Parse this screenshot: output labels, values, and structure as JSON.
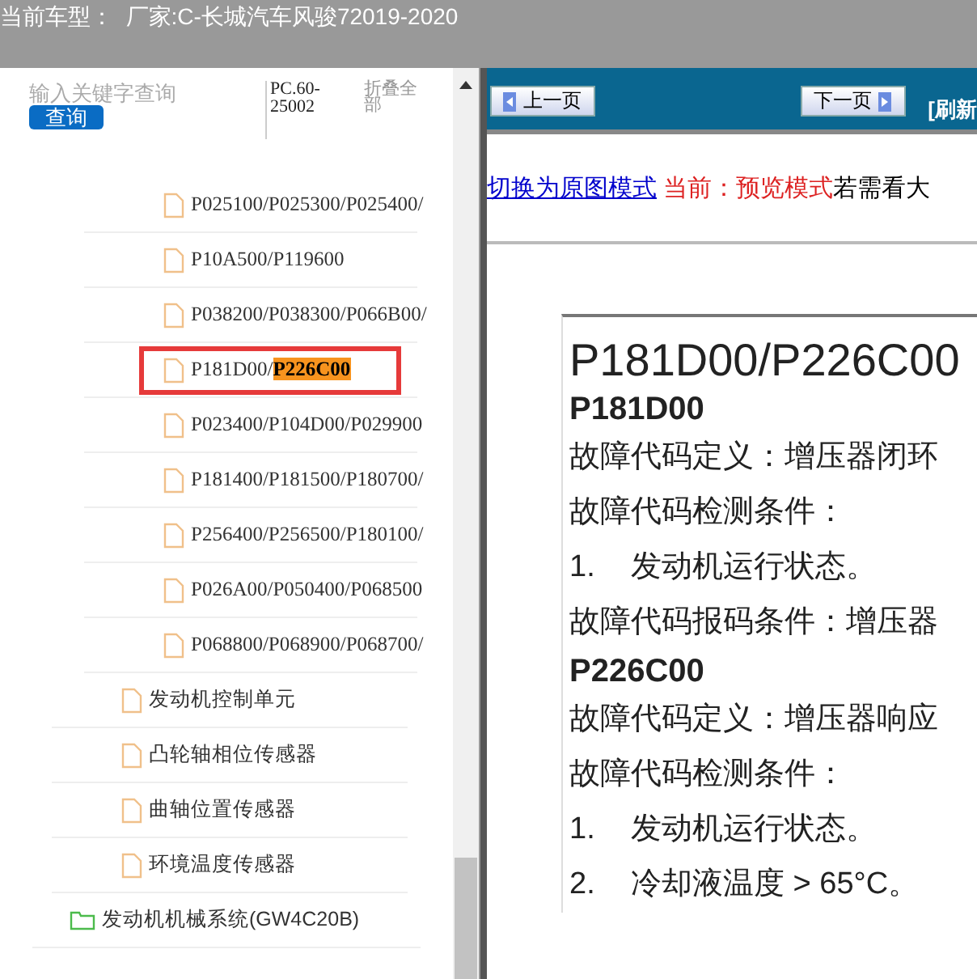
{
  "header": {
    "title": "当前车型：  厂家:C-长城汽车风骏72019-2020"
  },
  "search": {
    "placeholder": "输入关键字查询",
    "button": "查询",
    "code": "PC.60-25002",
    "collapse": "折叠全部"
  },
  "tree": [
    {
      "children": [
        {
          "children": [
            {
              "label": "P025100/P025300/P025400/",
              "kind": "file",
              "selected": false
            },
            {
              "label": "P10A500/P119600",
              "kind": "file",
              "selected": false
            },
            {
              "label": "P038200/P038300/P066B00/",
              "kind": "file",
              "selected": false
            },
            {
              "label": "P181D00/",
              "highlight": "P226C00",
              "kind": "file",
              "selected": true
            },
            {
              "label": "P023400/P104D00/P029900",
              "kind": "file",
              "selected": false
            },
            {
              "label": "P181400/P181500/P180700/",
              "kind": "file",
              "selected": false
            },
            {
              "label": "P256400/P256500/P180100/",
              "kind": "file",
              "selected": false
            },
            {
              "label": "P026A00/P050400/P068500",
              "kind": "file",
              "selected": false
            },
            {
              "label": "P068800/P068900/P068700/",
              "kind": "file",
              "selected": false
            }
          ]
        },
        {
          "label": "发动机控制单元",
          "kind": "file",
          "selected": false
        },
        {
          "label": "凸轮轴相位传感器",
          "kind": "file",
          "selected": false
        },
        {
          "label": "曲轴位置传感器",
          "kind": "file",
          "selected": false
        },
        {
          "label": "环境温度传感器",
          "kind": "file",
          "selected": false
        }
      ]
    },
    {
      "label": "发动机机械系统(GW4C20B)",
      "kind": "folder",
      "selected": false
    }
  ],
  "toolbar": {
    "prev": "上一页",
    "next": "下一页",
    "refresh": "[刷新"
  },
  "mode_bar": {
    "link": "切换为原图模式",
    "current": "当前：预览模式",
    "hint": "若需看大"
  },
  "document": {
    "title": "P181D00/P226C00",
    "lines": [
      {
        "kind": "heading",
        "text": "P181D00"
      },
      {
        "kind": "text",
        "text": "故障代码定义：增压器闭环"
      },
      {
        "kind": "text",
        "text": "故障代码检测条件："
      },
      {
        "kind": "item",
        "number": "1.",
        "text": "发动机运行状态。"
      },
      {
        "kind": "text",
        "text": "故障代码报码条件：增压器"
      },
      {
        "kind": "heading",
        "text": "P226C00"
      },
      {
        "kind": "text",
        "text": "故障代码定义：增压器响应"
      },
      {
        "kind": "text",
        "text": "故障代码检测条件："
      },
      {
        "kind": "item",
        "number": "1.",
        "text": "发动机运行状态。"
      },
      {
        "kind": "item",
        "number": "2.",
        "text": "冷却液温度 > 65°C。"
      }
    ]
  }
}
